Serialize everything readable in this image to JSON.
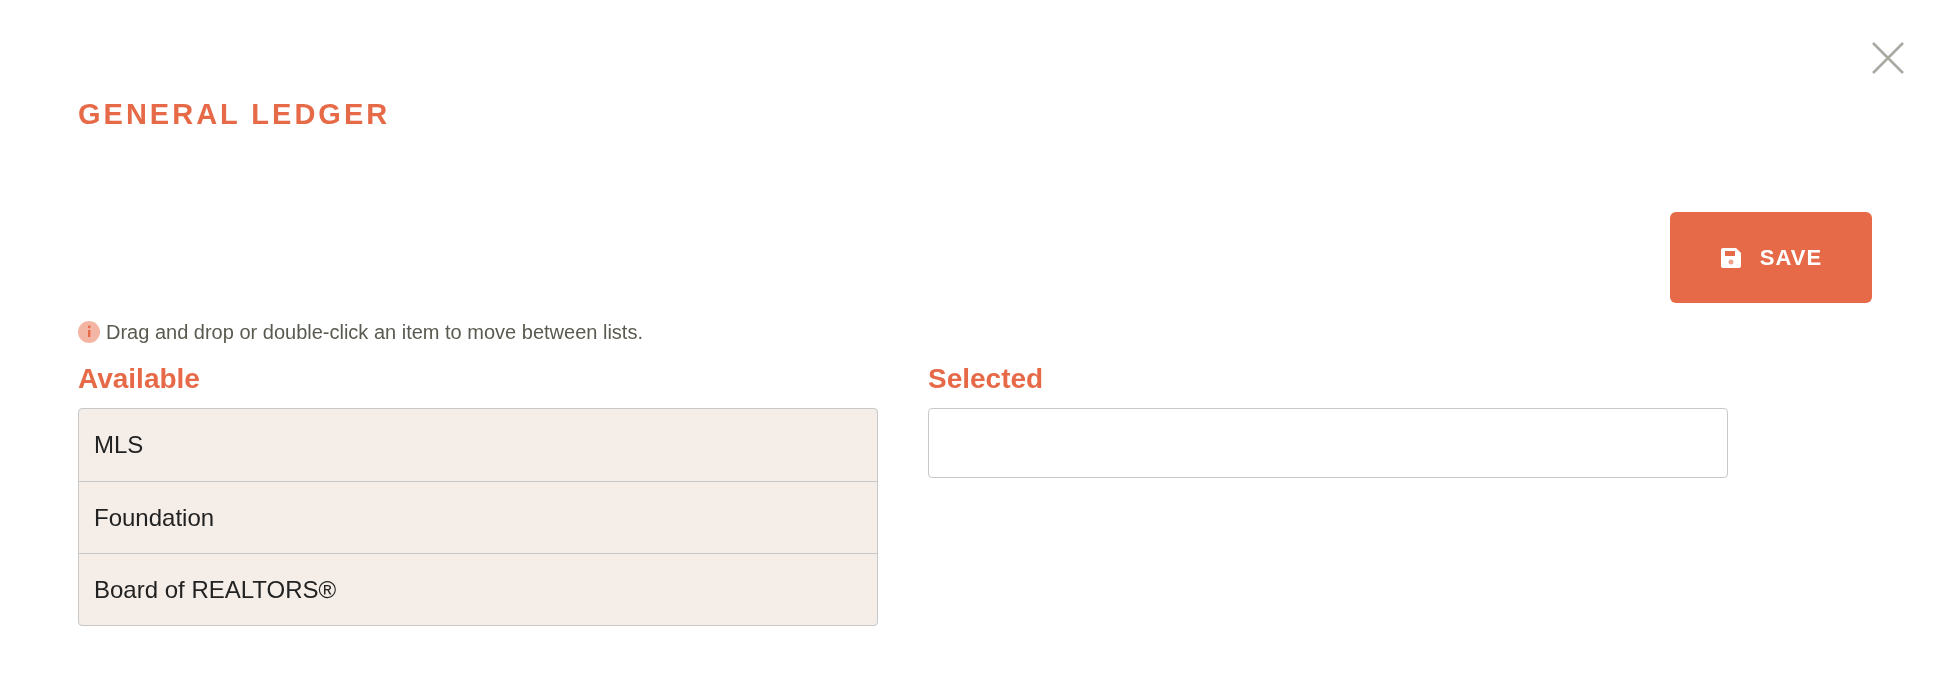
{
  "title": "GENERAL LEDGER",
  "save_button": {
    "label": "SAVE"
  },
  "hint": "Drag and drop or double-click an item to move between lists.",
  "available": {
    "heading": "Available",
    "items": [
      {
        "label": "MLS"
      },
      {
        "label": "Foundation"
      },
      {
        "label": "Board of REALTORS®"
      }
    ]
  },
  "selected": {
    "heading": "Selected"
  }
}
